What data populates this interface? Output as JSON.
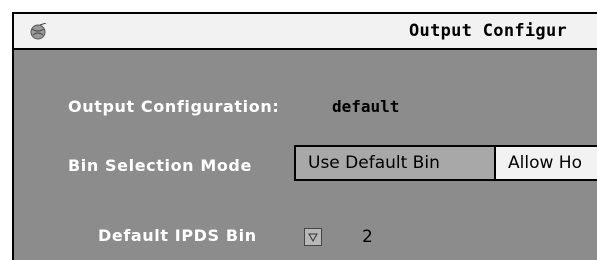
{
  "window": {
    "title": "Output Configur",
    "icon": "globe-icon"
  },
  "output_config": {
    "label": "Output Configuration:",
    "value": "default"
  },
  "bin_selection": {
    "label": "Bin Selection Mode",
    "options": [
      "Use Default Bin",
      "Allow Ho"
    ],
    "selected": "Use Default Bin"
  },
  "default_bin": {
    "label": "Default IPDS Bin",
    "value": "2"
  },
  "colors": {
    "panel": "#8c8c8c",
    "titlebar": "#f2f2f2",
    "selected_button": "#a8a8a8",
    "label_text": "#ffffff"
  }
}
